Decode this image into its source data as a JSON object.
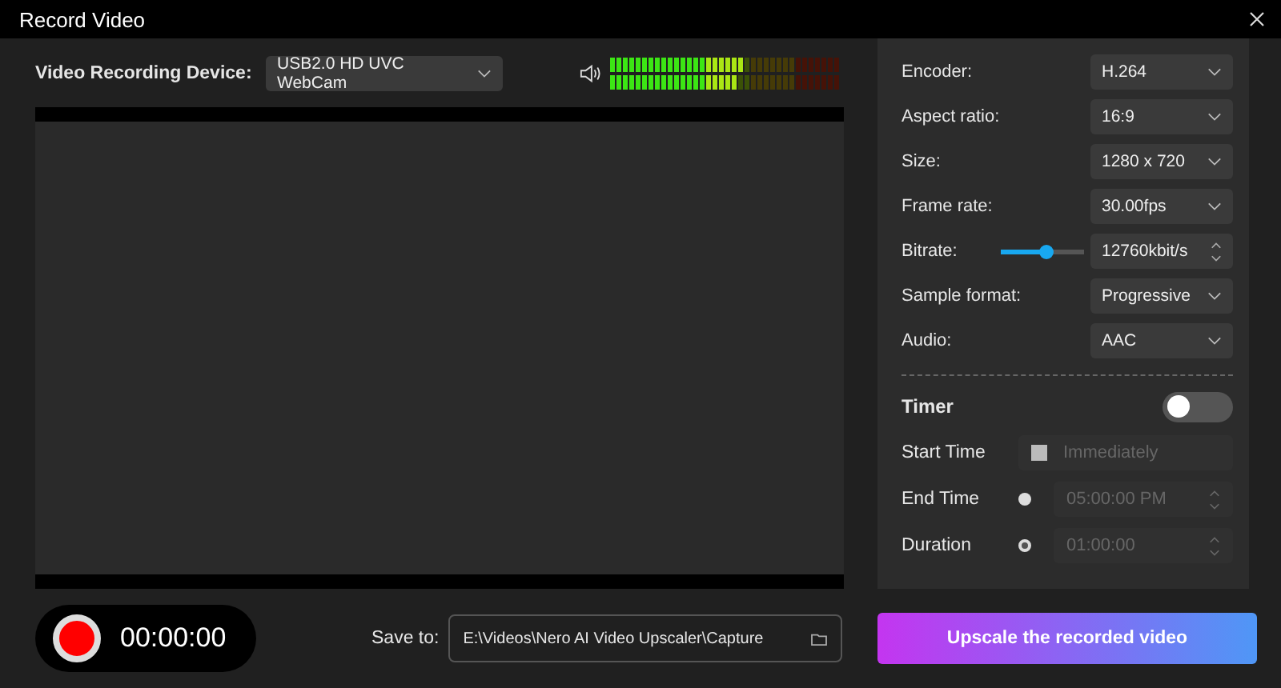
{
  "window": {
    "title": "Record Video"
  },
  "device": {
    "label": "Video Recording Device:",
    "value": "USB2.0 HD UVC WebCam"
  },
  "audio_meter": [
    {
      "level": 0.57
    },
    {
      "level": 0.56
    }
  ],
  "settings": [
    {
      "kind": "select",
      "label": "Encoder:",
      "value": "H.264"
    },
    {
      "kind": "select",
      "label": "Aspect ratio:",
      "value": "16:9"
    },
    {
      "kind": "select",
      "label": "Size:",
      "value": "1280 x 720"
    },
    {
      "kind": "select",
      "label": "Frame rate:",
      "value": "30.00fps"
    },
    {
      "kind": "slider",
      "label": "Bitrate:",
      "level": 0.55,
      "value": "12760kbit/s"
    },
    {
      "kind": "select",
      "label": "Sample format:",
      "value": "Progressive"
    },
    {
      "kind": "select",
      "label": "Audio:",
      "value": "AAC"
    }
  ],
  "timer": {
    "label": "Timer",
    "on": false,
    "start": {
      "label": "Start Time",
      "checked": false,
      "disabled": true,
      "option": "Immediately"
    },
    "end_options": [
      {
        "label": "End Time",
        "selected": false,
        "disabled": true,
        "value": "05:00:00 PM"
      },
      {
        "label": "Duration",
        "selected": true,
        "disabled": true,
        "value": "01:00:00"
      }
    ]
  },
  "recorder": {
    "elapsed": "00:00:00"
  },
  "save": {
    "label": "Save to:",
    "path": "E:\\Videos\\Nero AI Video Upscaler\\Capture"
  },
  "action_button": "Upscale the recorded video"
}
